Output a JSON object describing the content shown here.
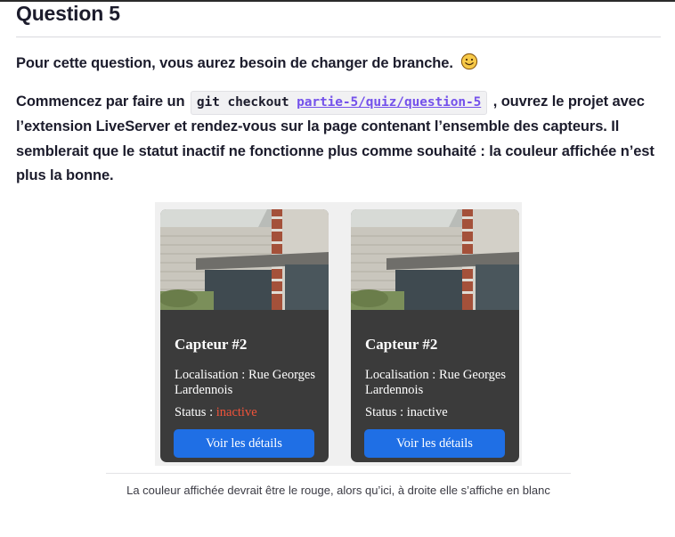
{
  "question": {
    "title": "Question 5"
  },
  "intro": {
    "text": "Pour cette question, vous aurez besoin de changer de branche.",
    "emoji_icon": "smiley-face-icon"
  },
  "instructions": {
    "before": "Commencez par faire un",
    "code_cmd": "git checkout",
    "code_branch": "partie-5/quiz/question-5",
    "after": ", ouvrez le projet avec l’extension LiveServer et rendez-vous sur la page contenant l’ensemble des capteurs. Il semblerait que le statut inactif ne fonctionne plus comme souhaité : la couleur affichée n’est plus la bonne."
  },
  "cards": [
    {
      "title": "Capteur #2",
      "location": "Localisation : Rue Georges Lardennois",
      "status_label": "Status :",
      "status_value": "inactive",
      "status_color": "#f1533a",
      "button": "Voir les détails"
    },
    {
      "title": "Capteur #2",
      "location": "Localisation : Rue Georges Lardennois",
      "status_label": "Status :",
      "status_value": "inactive",
      "status_color": "#ffffff",
      "button": "Voir les détails"
    }
  ],
  "caption": {
    "text": "La couleur affichée devrait être le rouge, alors qu’ici, à droite elle s’affiche en blanc"
  },
  "colors": {
    "link": "#7451eb",
    "button": "#1f6fe5",
    "card_bg": "#3b3b3b"
  }
}
